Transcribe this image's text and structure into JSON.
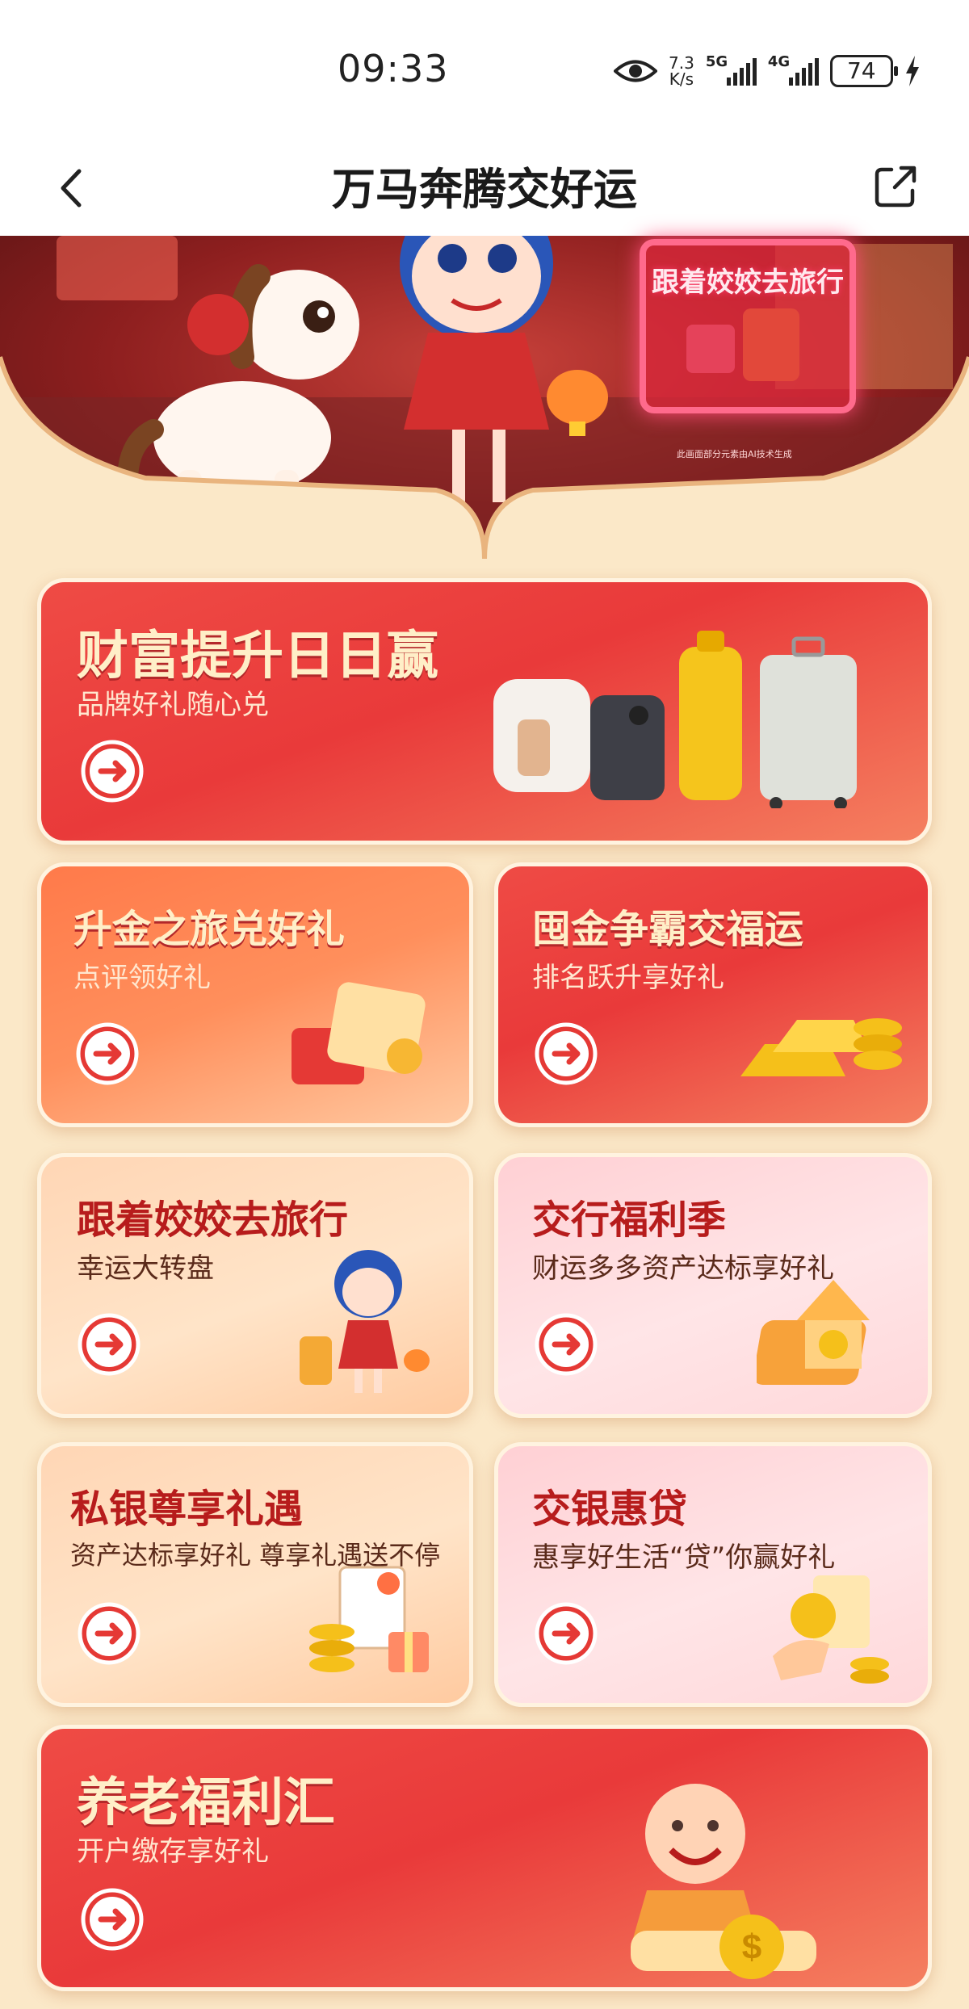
{
  "status_bar": {
    "time": "09:33",
    "speed_top": "7.3",
    "speed_bottom": "K/s",
    "sim1_label": "5G",
    "sim2_label": "4G",
    "battery": "74"
  },
  "nav": {
    "title": "万马奔腾交好运"
  },
  "banner": {
    "sign_text": "跟着姣姣去旅行",
    "ai_note": "此画面部分元素由AI技术生成"
  },
  "cards": [
    {
      "title": "财富提升日日赢",
      "subtitle": "品牌好礼随心兑"
    },
    {
      "title": "升金之旅兑好礼",
      "subtitle": "点评领好礼"
    },
    {
      "title": "囤金争霸交福运",
      "subtitle": "排名跃升享好礼"
    },
    {
      "title": "跟着姣姣去旅行",
      "subtitle": "幸运大转盘"
    },
    {
      "title": "交行福利季",
      "subtitle": "财运多多资产达标享好礼"
    },
    {
      "title": "私银尊享礼遇",
      "subtitle": "资产达标享好礼 尊享礼遇送不停"
    },
    {
      "title": "交银惠贷",
      "subtitle": "惠享好生活“贷”你赢好礼"
    },
    {
      "title": "养老福利汇",
      "subtitle": "开户缴存享好礼"
    }
  ]
}
